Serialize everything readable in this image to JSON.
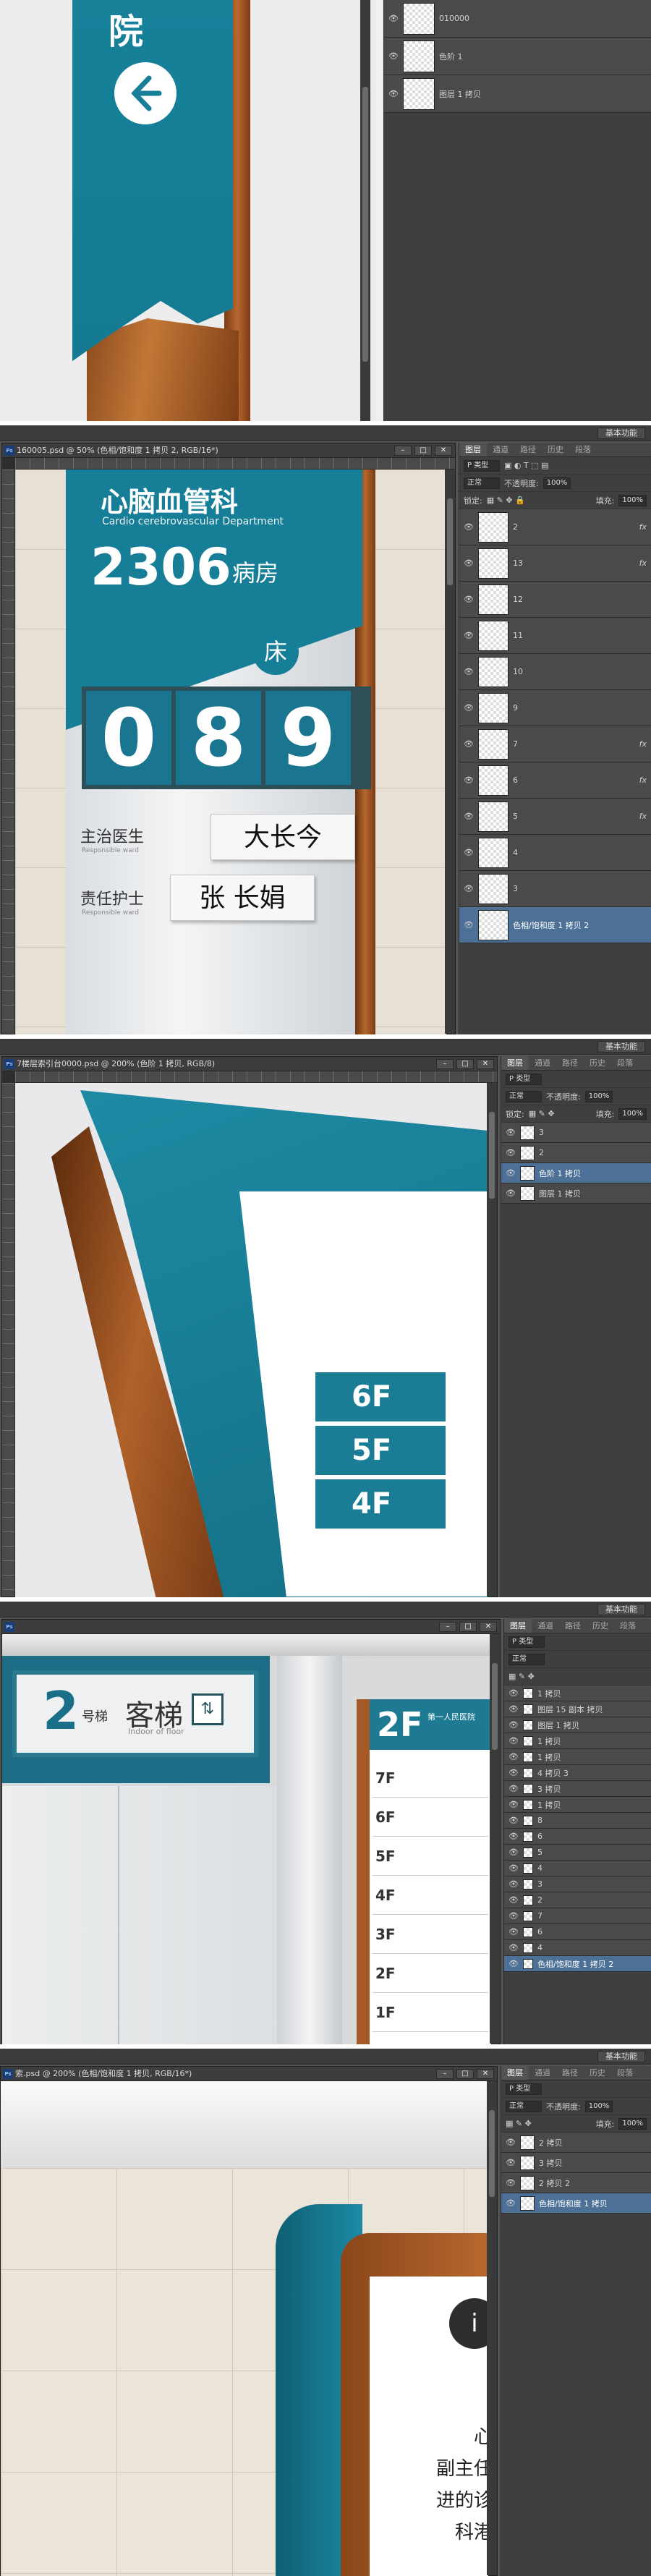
{
  "panel1": {
    "sign_char": "院",
    "layers": [
      {
        "name": "010000",
        "fx": false
      },
      {
        "name": "色阶 1",
        "fx": false
      },
      {
        "name": "图层 1 拷贝",
        "fx": false
      }
    ]
  },
  "panel2": {
    "workspace": "基本功能",
    "doc_title": "160005.psd @ 50% (色相/饱和度 1 拷贝 2, RGB/16*)",
    "tabs": [
      "图层",
      "通道",
      "路径",
      "历史",
      "段落"
    ],
    "kind_label": "P 类型",
    "blend": "正常",
    "opacity_label": "不透明度:",
    "opacity": "100%",
    "lock_label": "锁定:",
    "fill_label": "填充:",
    "fill": "100%",
    "sign": {
      "dept": "心脑血管科",
      "dept_en": "Cardio cerebrovascular Department",
      "ward_no": "2306",
      "ward_label": "病房",
      "bed_label": "床",
      "digits": [
        "0",
        "8",
        "9"
      ],
      "doctor_label": "主治医生",
      "doctor_en": "Responsible ward",
      "doctor_name": "大长今",
      "nurse_label": "责任护士",
      "nurse_en": "Responsible ward",
      "nurse_name": "张 长娟"
    },
    "layers": [
      {
        "name": "2",
        "fx": true
      },
      {
        "name": "13",
        "fx": true
      },
      {
        "name": "12",
        "fx": false
      },
      {
        "name": "11",
        "fx": false
      },
      {
        "name": "10",
        "fx": false
      },
      {
        "name": "9",
        "fx": false
      },
      {
        "name": "7",
        "fx": true
      },
      {
        "name": "6",
        "fx": true
      },
      {
        "name": "5",
        "fx": true
      },
      {
        "name": "4",
        "fx": false
      },
      {
        "name": "3",
        "fx": false
      },
      {
        "name": "色相/饱和度 1 拷贝 2",
        "fx": false,
        "selected": true
      }
    ]
  },
  "panel3": {
    "workspace": "基本功能",
    "doc_title": "7楼层索引台0000.psd @ 200% (色阶 1 拷贝, RGB/8)",
    "tabs": [
      "图层",
      "通道",
      "路径",
      "历史",
      "段落"
    ],
    "blend": "正常",
    "opacity_label": "不透明度:",
    "opacity": "100%",
    "lock_label": "锁定:",
    "fill_label": "填充:",
    "fill": "100%",
    "floors": [
      "6F",
      "5F",
      "4F"
    ],
    "layers": [
      {
        "name": "3",
        "selected": false
      },
      {
        "name": "2",
        "selected": false
      },
      {
        "name": "色阶 1 拷贝",
        "selected": true
      },
      {
        "name": "图层 1 拷贝",
        "selected": false
      }
    ]
  },
  "panel4": {
    "workspace": "基本功能",
    "elevator_no": "2",
    "elevator_label": "号梯",
    "elevator_name": "客梯",
    "elevator_en": "Indoor of floor",
    "floor_badge": "2F",
    "hospital": "第一人民医院",
    "directory": [
      "7F",
      "6F",
      "5F",
      "4F",
      "3F",
      "2F",
      "1F"
    ],
    "layers": [
      "1 拷贝",
      "图层 15 副本 拷贝",
      "图层 1 拷贝",
      "1 拷贝",
      "1 拷贝",
      "4 拷贝 3",
      "3 拷贝",
      "1 拷贝",
      "8",
      "6",
      "5",
      "4",
      "3",
      "2",
      "7",
      "6",
      "4",
      "色相/饱和度 1 拷贝 2"
    ]
  },
  "panel5": {
    "workspace": "基本功能",
    "doc_title": "索.psd @ 200% (色相/饱和度 1 拷贝, RGB/16*)",
    "tabs": [
      "图层",
      "通道",
      "路径",
      "历史",
      "段落"
    ],
    "blend": "正常",
    "opacity_label": "不透明度:",
    "opacity": "100%",
    "fill_label": "填充:",
    "fill": "100%",
    "sign_text": [
      "心",
      "副主任",
      "进的诊",
      "科港"
    ],
    "layers": [
      {
        "name": "2 拷贝",
        "selected": false
      },
      {
        "name": "3 拷贝",
        "selected": false
      },
      {
        "name": "2 拷贝 2",
        "selected": false
      },
      {
        "name": "色相/饱和度 1 拷贝",
        "selected": true
      }
    ]
  },
  "colors": {
    "teal": "#1a7f95",
    "wood": "#9a4f22",
    "ps_dark": "#535353"
  }
}
